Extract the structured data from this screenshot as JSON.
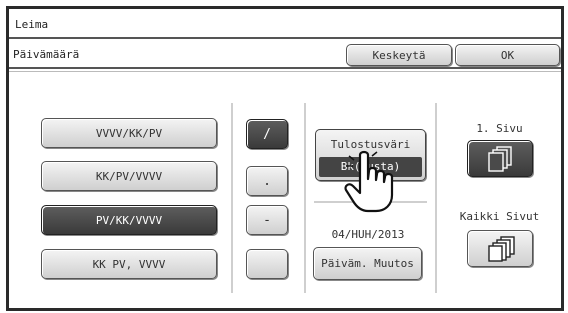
{
  "header": {
    "title": "Leima"
  },
  "subheader": {
    "label": "Päivämäärä",
    "cancel_label": "Keskeytä",
    "ok_label": "OK"
  },
  "formats": [
    {
      "label": "VVVV/KK/PV",
      "selected": false
    },
    {
      "label": "KK/PV/VVVV",
      "selected": false
    },
    {
      "label": "PV/KK/VVVV",
      "selected": true
    },
    {
      "label": "KK PV, VVVV",
      "selected": false
    }
  ],
  "separators": [
    {
      "label": "/",
      "selected": true
    },
    {
      "label": ".",
      "selected": false
    },
    {
      "label": "-",
      "selected": false
    },
    {
      "label": "",
      "selected": false
    }
  ],
  "print_color": {
    "label": "Tulostusväri",
    "value": "Bk(Musta)"
  },
  "date_value": "04/HUH/2013",
  "change_date_label": "Päiväm. Muutos",
  "pages": {
    "first_label": "1. Sivu",
    "all_label": "Kaikki Sivut",
    "first_selected": true,
    "all_selected": false
  },
  "icons": {
    "pointer": "hand-pointer-icon",
    "first_page": "single-page-stack-icon",
    "all_pages": "multi-page-stack-icon"
  },
  "colors": {
    "selected": "#4a4a4a",
    "button": "#e2e2e2",
    "border": "#2a2a2a"
  }
}
